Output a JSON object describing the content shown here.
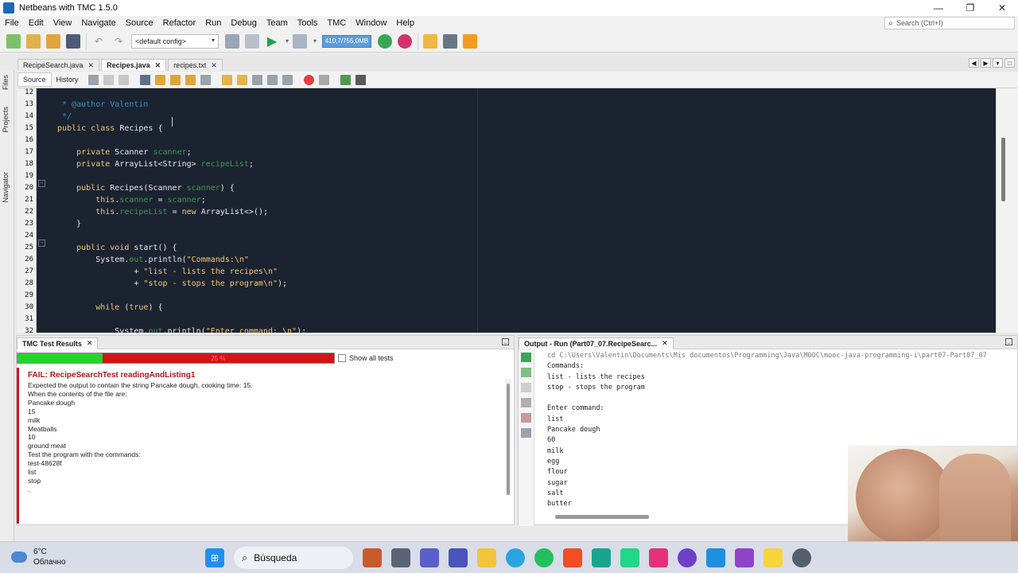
{
  "window": {
    "title": "Netbeans with TMC 1.5.0",
    "controls": [
      "—",
      "❐",
      "✕"
    ]
  },
  "menu": [
    "File",
    "Edit",
    "View",
    "Navigate",
    "Source",
    "Refactor",
    "Run",
    "Debug",
    "Team",
    "Tools",
    "TMC",
    "Window",
    "Help"
  ],
  "search": {
    "placeholder": "Search (Ctrl+I)"
  },
  "toolbar": {
    "config": "<default config>",
    "memory": "410,7/755,0MB"
  },
  "editor_tabs": [
    {
      "label": "RecipeSearch.java",
      "close": "✕"
    },
    {
      "label": "Recipes.java",
      "close": "✕"
    },
    {
      "label": "recipes.txt",
      "close": "✕"
    }
  ],
  "side_labels": [
    "Files",
    "Projects",
    "Navigator"
  ],
  "source_tabs": {
    "source": "Source",
    "history": "History"
  },
  "code": [
    {
      "n": "12",
      "parts": []
    },
    {
      "n": "13",
      "parts": [
        {
          "c": "cm",
          "t": "   * @author Valentin"
        }
      ]
    },
    {
      "n": "14",
      "parts": [
        {
          "c": "cm",
          "t": "   */"
        }
      ]
    },
    {
      "n": "15",
      "parts": [
        {
          "c": "kw",
          "t": "  public class "
        },
        {
          "c": "",
          "t": "Recipes {"
        }
      ]
    },
    {
      "n": "16",
      "parts": []
    },
    {
      "n": "17",
      "parts": [
        {
          "c": "kw",
          "t": "      private "
        },
        {
          "c": "",
          "t": "Scanner "
        },
        {
          "c": "fld",
          "t": "scanner"
        },
        {
          "c": "",
          "t": ";"
        }
      ]
    },
    {
      "n": "18",
      "parts": [
        {
          "c": "kw",
          "t": "      private "
        },
        {
          "c": "",
          "t": "ArrayList<String> "
        },
        {
          "c": "fld",
          "t": "recipeList"
        },
        {
          "c": "",
          "t": ";"
        }
      ]
    },
    {
      "n": "19",
      "parts": []
    },
    {
      "n": "20",
      "parts": [
        {
          "c": "kw",
          "t": "      public "
        },
        {
          "c": "",
          "t": "Recipes(Scanner "
        },
        {
          "c": "fld",
          "t": "scanner"
        },
        {
          "c": "",
          "t": ") {"
        }
      ]
    },
    {
      "n": "21",
      "parts": [
        {
          "c": "kw",
          "t": "          this"
        },
        {
          "c": "",
          "t": "."
        },
        {
          "c": "fld",
          "t": "scanner"
        },
        {
          "c": "",
          "t": " = "
        },
        {
          "c": "fld",
          "t": "scanner"
        },
        {
          "c": "",
          "t": ";"
        }
      ]
    },
    {
      "n": "22",
      "parts": [
        {
          "c": "kw",
          "t": "          this"
        },
        {
          "c": "",
          "t": "."
        },
        {
          "c": "fld",
          "t": "recipeList"
        },
        {
          "c": "",
          "t": " = "
        },
        {
          "c": "kw",
          "t": "new "
        },
        {
          "c": "",
          "t": "ArrayList<>();"
        }
      ]
    },
    {
      "n": "23",
      "parts": [
        {
          "c": "",
          "t": "      }"
        }
      ]
    },
    {
      "n": "24",
      "parts": []
    },
    {
      "n": "25",
      "parts": [
        {
          "c": "kw",
          "t": "      public void "
        },
        {
          "c": "",
          "t": "start() {"
        }
      ]
    },
    {
      "n": "26",
      "parts": [
        {
          "c": "",
          "t": "          System."
        },
        {
          "c": "fld",
          "t": "out"
        },
        {
          "c": "",
          "t": ".println("
        },
        {
          "c": "str",
          "t": "\"Commands:\\n\""
        }
      ]
    },
    {
      "n": "27",
      "parts": [
        {
          "c": "",
          "t": "                  + "
        },
        {
          "c": "str",
          "t": "\"list - lists the recipes\\n\""
        }
      ]
    },
    {
      "n": "28",
      "parts": [
        {
          "c": "",
          "t": "                  + "
        },
        {
          "c": "str",
          "t": "\"stop - stops the program\\n\""
        },
        {
          "c": "",
          "t": ");"
        }
      ]
    },
    {
      "n": "29",
      "parts": []
    },
    {
      "n": "30",
      "parts": [
        {
          "c": "kw",
          "t": "          while "
        },
        {
          "c": "",
          "t": "("
        },
        {
          "c": "kw",
          "t": "true"
        },
        {
          "c": "",
          "t": ") {"
        }
      ]
    },
    {
      "n": "31",
      "parts": []
    },
    {
      "n": "32",
      "parts": [
        {
          "c": "",
          "t": "              System."
        },
        {
          "c": "fld",
          "t": "out"
        },
        {
          "c": "",
          "t": ".println("
        },
        {
          "c": "str",
          "t": "\"Enter command: \\n\""
        },
        {
          "c": "",
          "t": ");"
        }
      ]
    }
  ],
  "test_panel": {
    "tab": "TMC Test Results",
    "close": "✕",
    "progress_fraction": 0.268,
    "progress_label": "25 %",
    "show_all": "Show all tests",
    "fail_title": "FAIL: RecipeSearchTest readingAndListing1",
    "lines": [
      "Expected the output to contain the string Pancake dough, cooking time: 15.",
      "When the contents of the file are:",
      "Pancake dough",
      "15",
      "milk",
      "",
      "Meatballs",
      "10",
      "ground meat",
      "",
      "Test the program with the commands:",
      "test-48628f",
      "list",
      "stop",
      "."
    ]
  },
  "output_panel": {
    "tab": "Output - Run (Part07_07.RecipeSearc...",
    "close": "✕",
    "lines": [
      "cd C:\\Users\\Valentin\\Documents\\Mis documentos\\Programming\\Java\\MOOC\\mooc-java-programming-i\\part07-Part07_07",
      "Commands:",
      "list - lists the recipes",
      "stop - stops the program",
      "",
      "Enter command:",
      "list",
      "Pancake dough",
      "60",
      "milk",
      "egg",
      "flour",
      "sugar",
      "salt",
      "butter"
    ]
  },
  "taskbar": {
    "temperature": "6°C",
    "weather": "Облачно",
    "search": "Búsqueda"
  },
  "colors": {
    "accent": "#1f66b8",
    "editor_bg": "#1b2331",
    "fail": "#d11414",
    "pass": "#25d42c"
  }
}
